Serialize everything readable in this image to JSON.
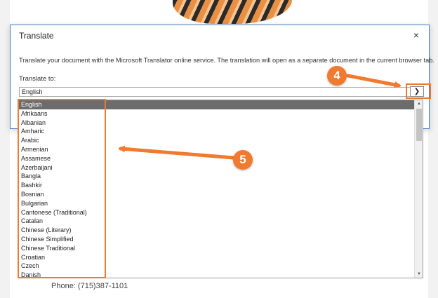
{
  "background": {
    "phone_text": "Phone: (715)387-1101"
  },
  "dialog": {
    "title": "Translate",
    "close_label": "×",
    "description": "Translate your document with the Microsoft Translator online service. The translation will open as a separate document in the current browser tab.",
    "translate_to_label": "Translate to:",
    "selected_language": "English",
    "dropdown_arrow": "chevron-down-icon"
  },
  "language_list": [
    "English",
    "Afrikaans",
    "Albanian",
    "Amharic",
    "Arabic",
    "Armenian",
    "Assamese",
    "Azerbaijani",
    "Bangla",
    "Bashkir",
    "Bosnian",
    "Bulgarian",
    "Cantonese (Traditional)",
    "Catalan",
    "Chinese (Literary)",
    "Chinese Simplified",
    "Chinese Traditional",
    "Croatian",
    "Czech",
    "Danish"
  ],
  "annotations": {
    "badge_4": "4",
    "badge_5": "5",
    "accent_color": "#f07a2f"
  }
}
